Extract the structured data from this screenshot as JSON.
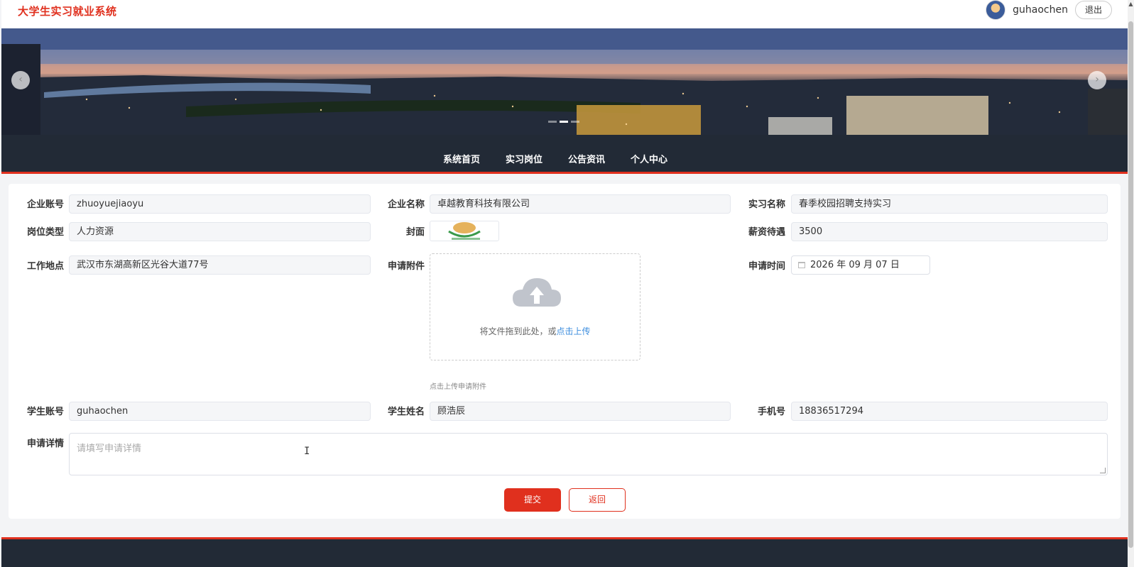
{
  "header": {
    "site_title": "大学生实习就业系统",
    "username": "guhaochen",
    "logout_label": "退出"
  },
  "banner": {
    "prev_label": "‹",
    "next_label": "›",
    "slides": 3,
    "active_slide": 2
  },
  "nav": {
    "items": [
      "系统首页",
      "实习岗位",
      "公告资讯",
      "个人中心"
    ]
  },
  "form": {
    "company_account": {
      "label": "企业账号",
      "value": "zhuoyuejiaoyu"
    },
    "company_name": {
      "label": "企业名称",
      "value": "卓越教育科技有限公司"
    },
    "internship_name": {
      "label": "实习名称",
      "value": "春季校园招聘支持实习"
    },
    "position_type": {
      "label": "岗位类型",
      "value": "人力资源"
    },
    "cover": {
      "label": "封面"
    },
    "salary": {
      "label": "薪资待遇",
      "value": "3500"
    },
    "work_location": {
      "label": "工作地点",
      "value": "武汉市东湖高新区光谷大道77号"
    },
    "attachment": {
      "label": "申请附件",
      "drop_text": "将文件拖到此处，或",
      "upload_link": "点击上传",
      "tip": "点击上传申请附件"
    },
    "apply_time": {
      "label": "申请时间",
      "value": "2026 年 09 月 07 日"
    },
    "student_account": {
      "label": "学生账号",
      "value": "guhaochen"
    },
    "student_name": {
      "label": "学生姓名",
      "value": "顾浩辰"
    },
    "phone": {
      "label": "手机号",
      "value": "18836517294"
    },
    "details": {
      "label": "申请详情",
      "placeholder": "请填写申请详情"
    },
    "submit_label": "提交",
    "back_label": "返回"
  },
  "colors": {
    "accent": "#e0301e",
    "nav_bg": "#222a36",
    "link": "#3c8dde"
  }
}
